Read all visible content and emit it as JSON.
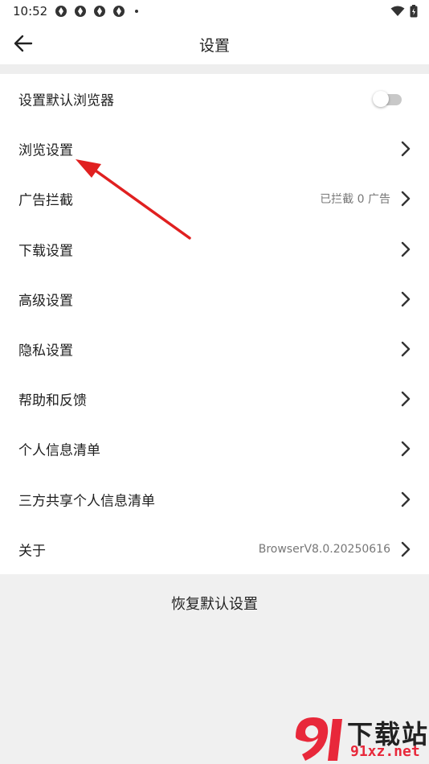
{
  "status_bar": {
    "time": "10:52",
    "notification_icons": [
      "app-notification-icon",
      "app-notification-icon",
      "app-notification-icon",
      "app-notification-icon"
    ],
    "system_icons": [
      "wifi-icon",
      "battery-icon"
    ]
  },
  "header": {
    "title": "设置",
    "back_icon": "arrow-left-icon"
  },
  "settings": {
    "items": [
      {
        "label": "设置默认浏览器",
        "control": "toggle",
        "toggle_on": false
      },
      {
        "label": "浏览设置",
        "control": "chevron"
      },
      {
        "label": "广告拦截",
        "value": "已拦截 0 广告",
        "control": "chevron"
      },
      {
        "label": "下载设置",
        "control": "chevron"
      },
      {
        "label": "高级设置",
        "control": "chevron"
      },
      {
        "label": "隐私设置",
        "control": "chevron"
      },
      {
        "label": "帮助和反馈",
        "control": "chevron"
      },
      {
        "label": "个人信息清单",
        "control": "chevron"
      },
      {
        "label": "三方共享个人信息清单",
        "control": "chevron"
      },
      {
        "label": "关于",
        "value": "BrowserV8.0.20250616",
        "control": "chevron"
      }
    ]
  },
  "footer": {
    "restore_label": "恢复默认设置"
  },
  "watermark": {
    "brand": "下载站",
    "url": "91xz.net"
  },
  "colors": {
    "background": "#f0f0f0",
    "card": "#ffffff",
    "annotation_arrow": "#e02020",
    "watermark_red": "#e8283a"
  }
}
